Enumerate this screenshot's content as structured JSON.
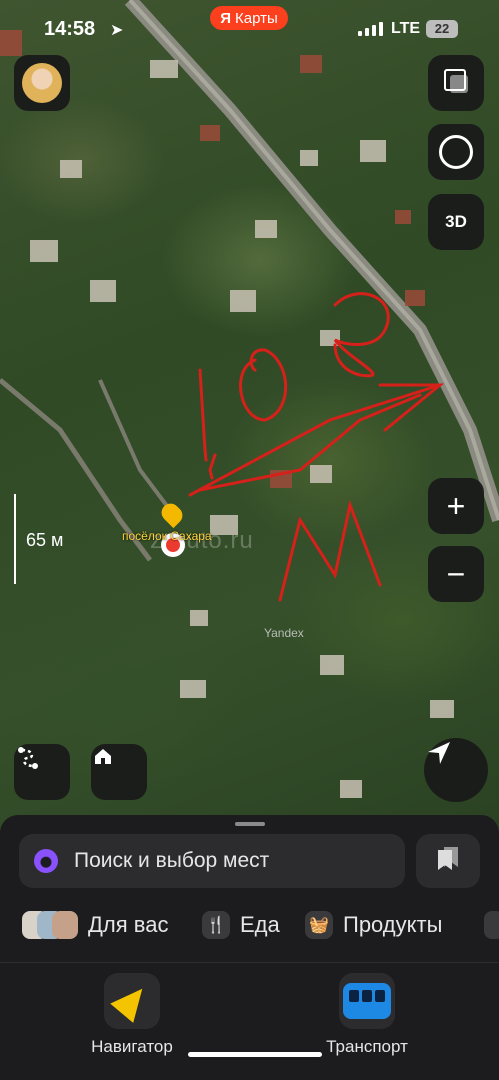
{
  "status_bar": {
    "time": "14:58",
    "app_pill": "Карты",
    "app_pill_logo": "Я",
    "network": "LTE",
    "battery": "22"
  },
  "map": {
    "scale_label": "65 м",
    "place_label": "посёлок Сахара",
    "provider_mark": "Yandex",
    "watermark": "z-auto.ru",
    "buttons": {
      "three_d": "3D",
      "zoom_in": "+",
      "zoom_out": "−"
    }
  },
  "sheet": {
    "search_placeholder": "Поиск и выбор мест",
    "categories": [
      {
        "label": "Для вас",
        "icon": "people-avatars-icon"
      },
      {
        "label": "Еда",
        "icon": "fork-knife-icon"
      },
      {
        "label": "Продукты",
        "icon": "basket-icon"
      }
    ],
    "tabs": [
      {
        "label": "Навигатор",
        "icon": "navigator-arrow-icon"
      },
      {
        "label": "Транспорт",
        "icon": "bus-icon"
      }
    ]
  },
  "colors": {
    "brand": "#fc3f1d",
    "accent_yellow": "#f5c400",
    "sheet_bg": "#1c1c1e",
    "annotation_red": "#d6201a"
  }
}
